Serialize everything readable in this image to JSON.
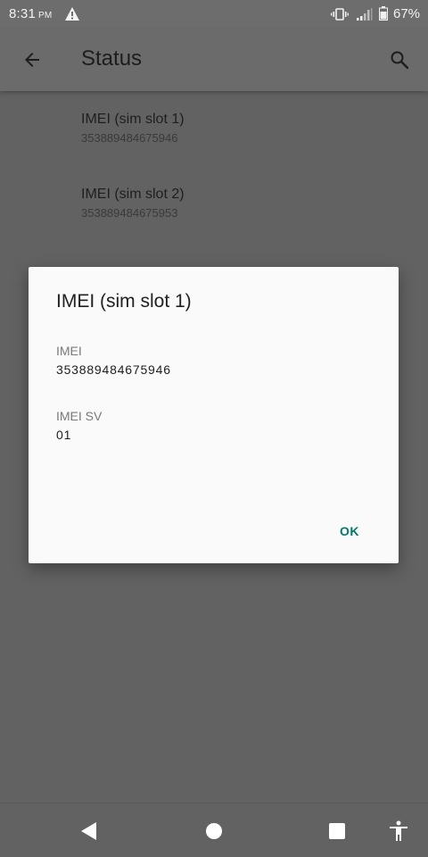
{
  "status_bar": {
    "time": "8:31",
    "ampm": "PM",
    "battery_percent": "67%",
    "icons": [
      "warning-icon",
      "vibrate-icon",
      "signal-icon",
      "battery-icon"
    ]
  },
  "app_bar": {
    "title": "Status",
    "icons": [
      "back-arrow-icon",
      "search-icon"
    ]
  },
  "list": {
    "items": [
      {
        "title": "IMEI (sim slot 1)",
        "summary": "353889484675946"
      },
      {
        "title": "IMEI (sim slot 2)",
        "summary": "353889484675953"
      }
    ]
  },
  "dialog": {
    "title": "IMEI (sim slot 1)",
    "fields": [
      {
        "label": "IMEI",
        "value": "353889484675946"
      },
      {
        "label": "IMEI SV",
        "value": "01"
      }
    ],
    "ok_label": "OK"
  },
  "nav_bar": {
    "icons": [
      "back-triangle-icon",
      "home-circle-icon",
      "recents-square-icon",
      "accessibility-icon"
    ]
  },
  "colors": {
    "accent": "#00796b",
    "scrim_background": "#626262",
    "dialog_background": "#fafafa"
  }
}
